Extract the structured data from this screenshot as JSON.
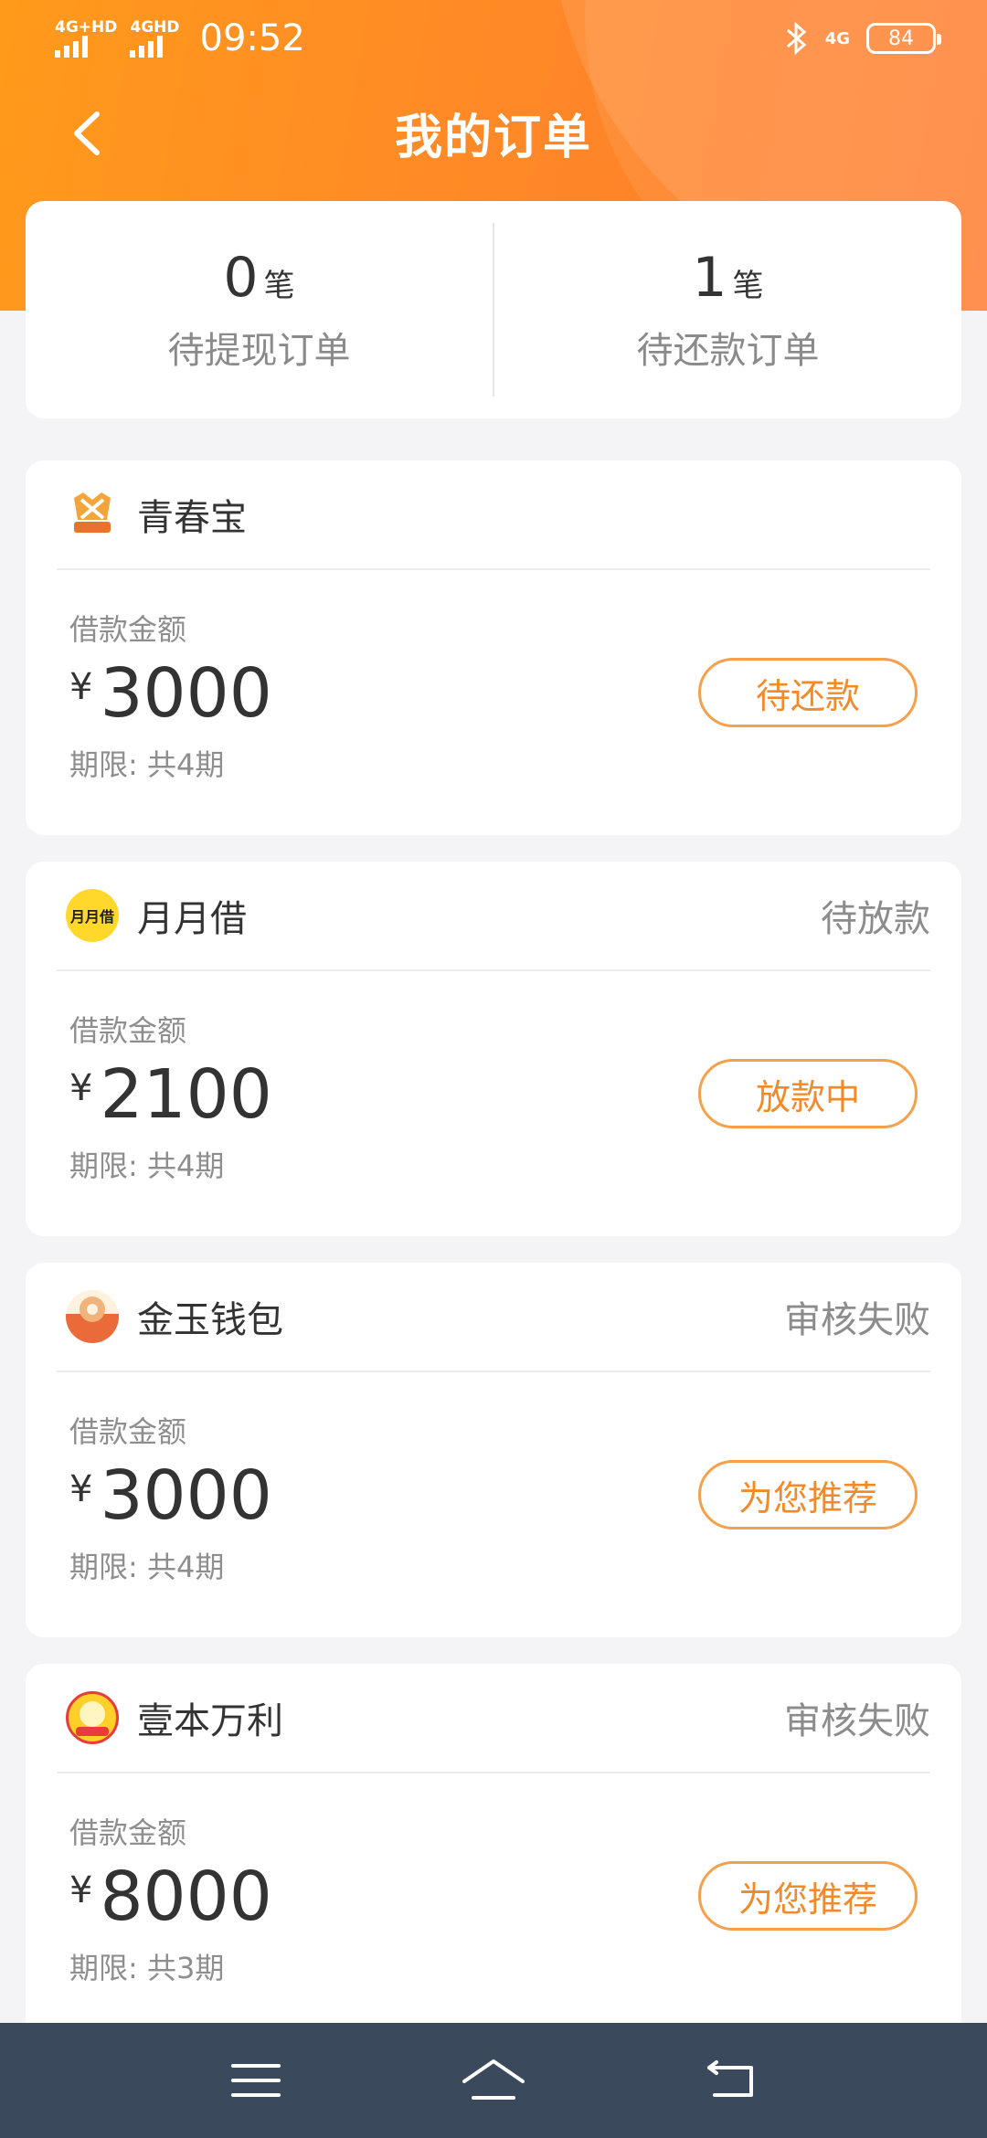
{
  "status_bar": {
    "network1": "4G+HD",
    "network2": "4GHD",
    "time": "09:52",
    "network3": "4G",
    "battery": "84"
  },
  "header": {
    "title": "我的订单"
  },
  "summary": {
    "pending_withdraw": {
      "count": "0",
      "unit": "笔",
      "label": "待提现订单"
    },
    "pending_repay": {
      "count": "1",
      "unit": "笔",
      "label": "待还款订单"
    }
  },
  "orders": [
    {
      "lender": "青春宝",
      "status": "",
      "amount_label": "借款金额",
      "currency": "¥",
      "amount": "3000",
      "term": "期限: 共4期",
      "action": "待还款",
      "logo": "qingchunbao-logo-icon"
    },
    {
      "lender": "月月借",
      "status": "待放款",
      "amount_label": "借款金额",
      "currency": "¥",
      "amount": "2100",
      "term": "期限: 共4期",
      "action": "放款中",
      "logo_text": "月月借"
    },
    {
      "lender": "金玉钱包",
      "status": "审核失败",
      "amount_label": "借款金额",
      "currency": "¥",
      "amount": "3000",
      "term": "期限: 共4期",
      "action": "为您推荐",
      "logo": "jinyu-wallet-logo-icon"
    },
    {
      "lender": "壹本万利",
      "status": "审核失败",
      "amount_label": "借款金额",
      "currency": "¥",
      "amount": "8000",
      "term": "期限: 共3期",
      "action": "为您推荐",
      "logo": "yibenwanli-logo-icon"
    }
  ],
  "nav": {
    "icons": [
      "menu-icon",
      "home-icon",
      "back-icon"
    ]
  },
  "colors": {
    "accent": "#ff8a26",
    "button_border": "#f5a04a",
    "button_text": "#f38a2a",
    "nav_bg": "#3a4a5c"
  }
}
